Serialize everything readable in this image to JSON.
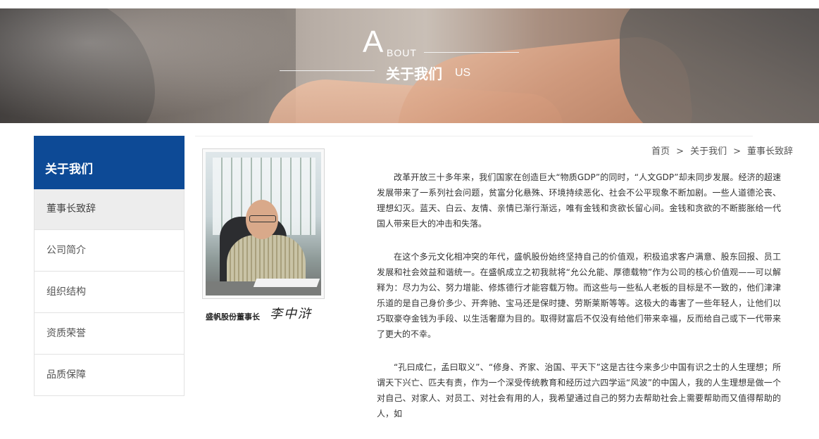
{
  "banner": {
    "letter": "A",
    "bout": "BOUT",
    "title_cn": "关于我们",
    "us": "US"
  },
  "sidebar": {
    "heading": "关于我们",
    "items": [
      {
        "label": "董事长致辞",
        "active": true
      },
      {
        "label": "公司简介",
        "active": false
      },
      {
        "label": "组织结构",
        "active": false
      },
      {
        "label": "资质荣誉",
        "active": false
      },
      {
        "label": "品质保障",
        "active": false
      }
    ]
  },
  "breadcrumb": {
    "home": "首页",
    "separator": ">",
    "section": "关于我们",
    "current": "董事长致辞"
  },
  "portrait": {
    "caption": "盛帆股份董事长",
    "signature": "李中浒"
  },
  "article": {
    "paragraphs": [
      "改革开放三十多年来，我们国家在创造巨大“物质GDP”的同时，“人文GDP”却未同步发展。经济的超速发展带来了一系列社会问题，贫富分化悬殊、环境持续恶化、社会不公平现象不断加剧。一些人道德沦丧、理想幻灭。蓝天、白云、友情、亲情已渐行渐远，唯有金钱和贪欲长留心间。金钱和贪欲的不断膨胀给一代国人带来巨大的冲击和失落。",
      "在这个多元文化相冲突的年代，盛帆股份始终坚持自己的价值观，积极追求客户满意、股东回报、员工发展和社会效益和谐统一。在盛帆成立之初我就将“允公允能、厚德载物”作为公司的核心价值观——可以解释为：尽力为公、努力增能、修炼德行才能容载万物。而这些与一些私人老板的目标是不一致的，他们津津乐道的是自己身价多少、开奔驰、宝马还是保时捷、劳斯莱斯等等。这极大的毒害了一些年轻人，让他们以巧取豪夺金钱为手段、以生活奢靡为目的。取得财富后不仅没有给他们带来幸福，反而给自己或下一代带来了更大的不幸。",
      "“孔曰成仁，孟曰取义”、“修身、齐家、治国、平天下”这是古往今来多少中国有识之士的人生理想；所谓天下兴亡、匹夫有责，作为一个深受传统教育和经历过六四学运“风波”的中国人，我的人生理想是做一个对自己、对家人、对员工、对社会有用的人，我希望通过自己的努力去帮助社会上需要帮助而又值得帮助的人，如"
    ]
  },
  "colors": {
    "sidebar_heading_bg": "#0d4a96",
    "active_item_bg": "#ededed"
  }
}
